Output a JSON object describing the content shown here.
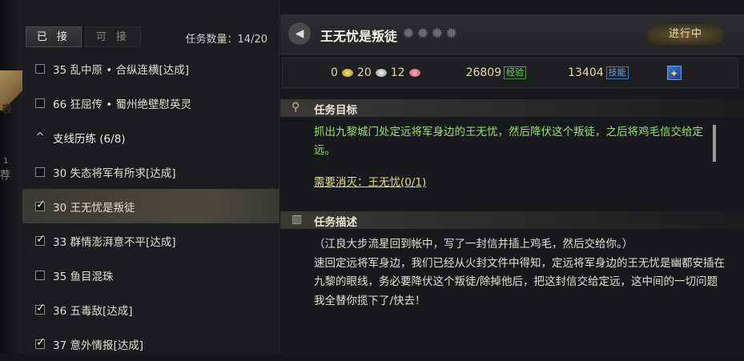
{
  "edge": {
    "chars": [
      "1",
      "表",
      "荐"
    ]
  },
  "left": {
    "tabs": [
      {
        "label": "已 接",
        "active": true
      },
      {
        "label": "可 接",
        "active": false
      }
    ],
    "quest_count_label": "任务数量：",
    "quest_count_value": "14/20",
    "items": [
      {
        "kind": "quest",
        "checked": false,
        "label": "35 乱中原 • 合纵连横[达成]"
      },
      {
        "kind": "quest",
        "checked": false,
        "label": "66 狂屈传 • 蜀州绝壁慰英灵"
      },
      {
        "kind": "group",
        "label": "支线历练 (6/8)"
      },
      {
        "kind": "quest",
        "checked": false,
        "label": "30 失态将军有所求[达成]"
      },
      {
        "kind": "quest",
        "checked": true,
        "selected": true,
        "label": "30 王无忧是叛徒"
      },
      {
        "kind": "quest",
        "checked": true,
        "label": "33 群情澎湃意不平[达成]"
      },
      {
        "kind": "quest",
        "checked": false,
        "label": "35 鱼目混珠"
      },
      {
        "kind": "quest",
        "checked": true,
        "label": "36 五毒敌[达成]"
      },
      {
        "kind": "quest",
        "checked": true,
        "label": "37 意外情报[达成]"
      }
    ]
  },
  "right": {
    "title": "王无忧是叛徒",
    "status": "进行中",
    "rewards": {
      "gold": "0",
      "silver": "20",
      "copper": "12",
      "exp_value": "26809",
      "exp_tag": "经验",
      "skill_value": "13404",
      "skill_tag": "技能"
    },
    "goal_header": "任务目标",
    "goal_text": "抓出九黎城门处定远将军身边的王无忧，然后降伏这个叛徒，之后将鸡毛信交给定远。",
    "need_text": "需要消灭：王无忧(0/1)",
    "desc_header": "任务描述",
    "desc_text": "（江良大步流星回到帐中，写了一封信并插上鸡毛，然后交给你。）",
    "desc_text2": "速回定远将军身边，我们已经从火封文件中得知，定远将军身边的王无忧是幽都安插在九黎的眼线，务必要降伏这个叛徒/除掉他后，把这封信交给定远，这中间的一切问题我全替你揽下了/快去！"
  },
  "colors": {
    "goal_green": "#96e36a",
    "need_yellow": "#e8dd82",
    "status_gold": "#f2dfa6"
  }
}
